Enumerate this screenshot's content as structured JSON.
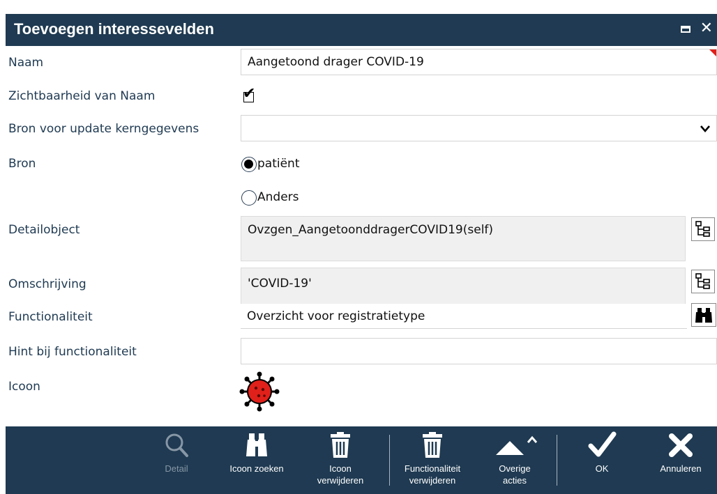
{
  "window": {
    "title": "Toevoegen interessevelden"
  },
  "form": {
    "naam": {
      "label": "Naam",
      "value": "Aangetoond drager COVID-19"
    },
    "zichtbaarheid": {
      "label": "Zichtbaarheid van Naam",
      "checked": true
    },
    "bron_update": {
      "label": "Bron voor update kerngegevens",
      "value": ""
    },
    "bron": {
      "label": "Bron",
      "options": [
        "patiënt",
        "Anders"
      ],
      "selected": "patiënt"
    },
    "detailobject": {
      "label": "Detailobject",
      "value": "Ovzgen_AangetoonddragerCOVID19(self)"
    },
    "omschrijving": {
      "label": "Omschrijving",
      "value": "'COVID-19'"
    },
    "functionaliteit": {
      "label": "Functionaliteit",
      "value": "Overzicht voor registratietype"
    },
    "hint": {
      "label": "Hint bij functionaliteit",
      "value": ""
    },
    "icoon": {
      "label": "Icoon",
      "icon": "virus-icon",
      "color": "#e0201a"
    }
  },
  "toolbar": {
    "detail": "Detail",
    "icoon_zoeken": "Icoon zoeken",
    "icoon_verwijderen_1": "Icoon",
    "icoon_verwijderen_2": "verwijderen",
    "func_verwijderen_1": "Functionaliteit",
    "func_verwijderen_2": "verwijderen",
    "overige_1": "Overige",
    "overige_2": "acties",
    "ok": "OK",
    "annuleren": "Annuleren"
  },
  "colors": {
    "titlebar": "#1f3a52",
    "accent_red": "#e0201a"
  }
}
